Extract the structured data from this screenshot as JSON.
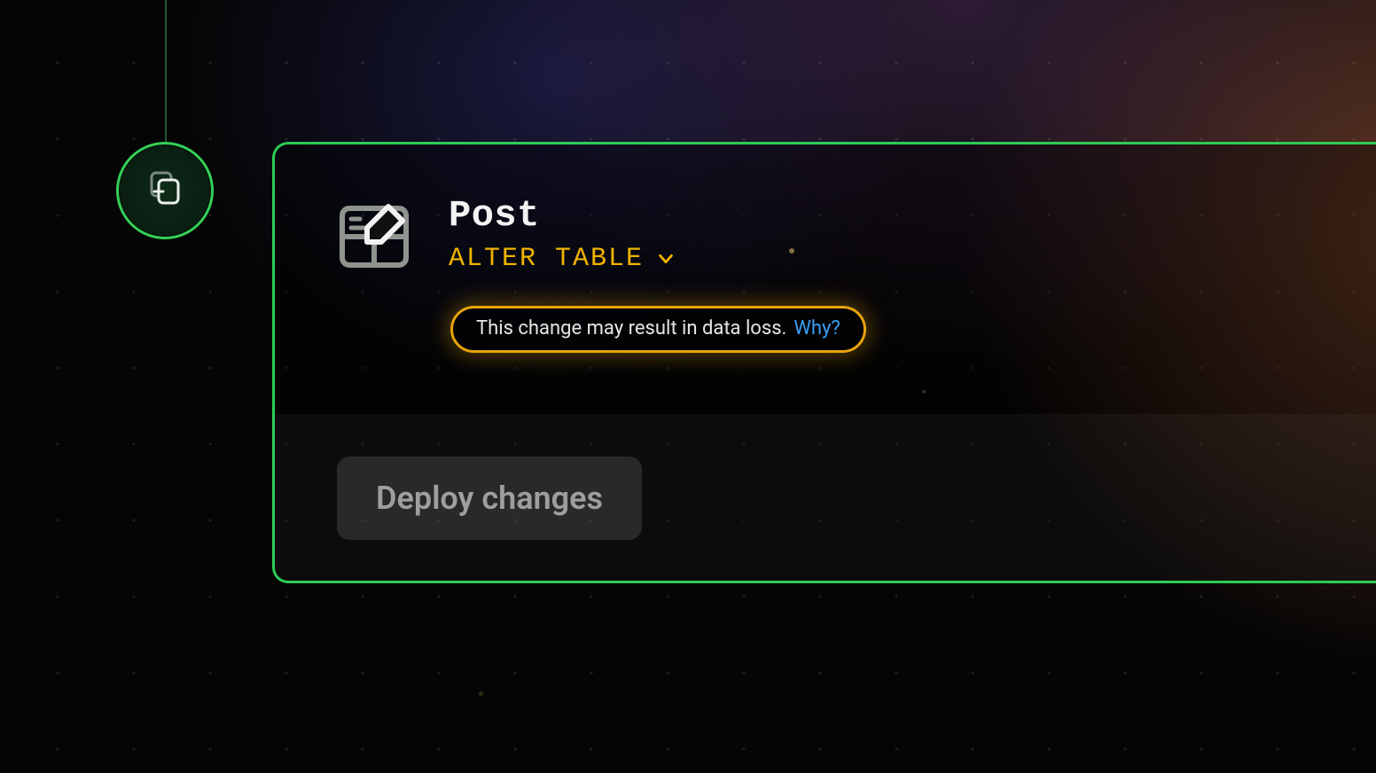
{
  "model": {
    "name": "Post",
    "operation_label": "ALTER TABLE"
  },
  "warning": {
    "message": "This change may result in data loss.",
    "why_label": "Why?"
  },
  "actions": {
    "deploy_label": "Deploy changes"
  },
  "colors": {
    "accent_green": "#2ecc55",
    "accent_amber": "#e8a40c",
    "link_blue": "#3a9df2"
  }
}
